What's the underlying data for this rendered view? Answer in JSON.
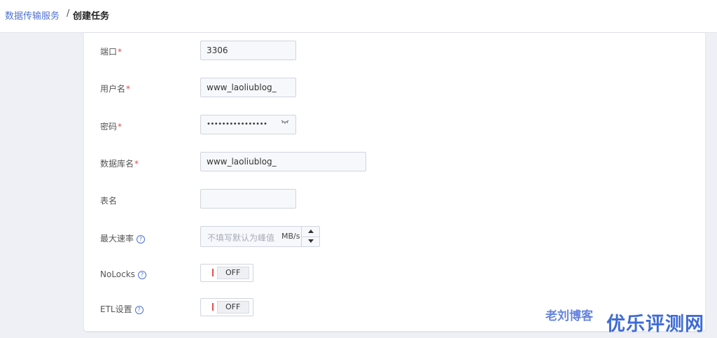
{
  "breadcrumb": {
    "parent": "数据传输服务",
    "separator": "/",
    "current": "创建任务"
  },
  "form": {
    "port": {
      "label": "端口",
      "required": "*",
      "value": "3306"
    },
    "username": {
      "label": "用户名",
      "required": "*",
      "value": "www_laoliublog_"
    },
    "password": {
      "label": "密码",
      "required": "*",
      "value": "••••••••••••••••"
    },
    "database": {
      "label": "数据库名",
      "required": "*",
      "value": "www_laoliublog_"
    },
    "table": {
      "label": "表名",
      "value": ""
    },
    "max_rate": {
      "label": "最大速率",
      "placeholder": "不填写默认为峰值",
      "unit": "MB/s"
    },
    "nolocks": {
      "label": "NoLocks",
      "state": "OFF"
    },
    "etl": {
      "label": "ETL设置",
      "state": "OFF"
    },
    "help_glyph": "?"
  },
  "watermark": {
    "text1": "老刘博客",
    "text2": "优乐评测网"
  },
  "colors": {
    "accent": "#4e72d6",
    "required": "#e34d4d",
    "watermark": "#2b5bd0"
  },
  "icons": [
    "help-icon",
    "eye-closed-icon",
    "arrow-up-icon",
    "arrow-down-icon"
  ]
}
